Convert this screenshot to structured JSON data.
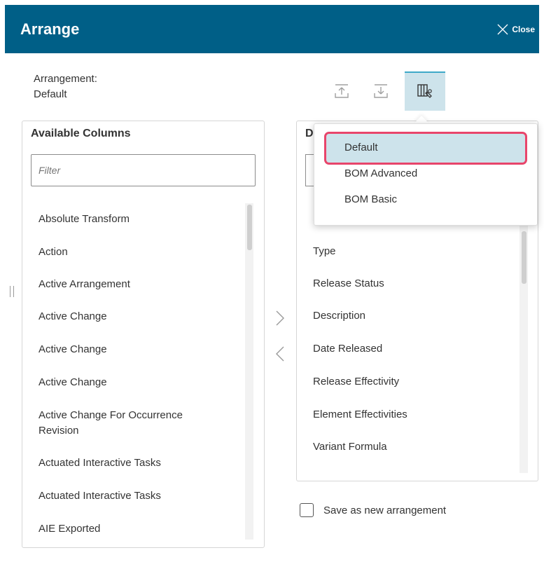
{
  "dialog": {
    "title": "Arrange",
    "close_label": "Close",
    "arrangement_label": "Arrangement:",
    "arrangement_value": "Default"
  },
  "toolbar": {
    "icons": [
      "upload-arrangement-icon",
      "download-arrangement-icon",
      "manage-arrangement-icon"
    ]
  },
  "available_columns": {
    "title": "Available Columns",
    "filter_placeholder": "Filter",
    "items": [
      "Absolute Transform",
      "Action",
      "Active Arrangement",
      "Active Change",
      "Active Change",
      "Active Change",
      "Active Change For Occurrence Revision",
      "Actuated Interactive Tasks",
      "Actuated Interactive Tasks",
      "AIE Exported"
    ]
  },
  "displayed_columns": {
    "title_visible_fragment": "D",
    "items": [
      "Type",
      "Release Status",
      "Description",
      "Date Released",
      "Release Effectivity",
      "Element Effectivities",
      "Variant Formula"
    ]
  },
  "arrangement_menu": {
    "items": [
      "Default",
      "BOM Advanced",
      "BOM Basic"
    ],
    "selected": "Default"
  },
  "save_new": {
    "label": "Save as new arrangement",
    "checked": false
  },
  "colors": {
    "header_bg": "#005f87",
    "selected_bg": "#cde3eb",
    "highlight_border": "#e8456b"
  }
}
